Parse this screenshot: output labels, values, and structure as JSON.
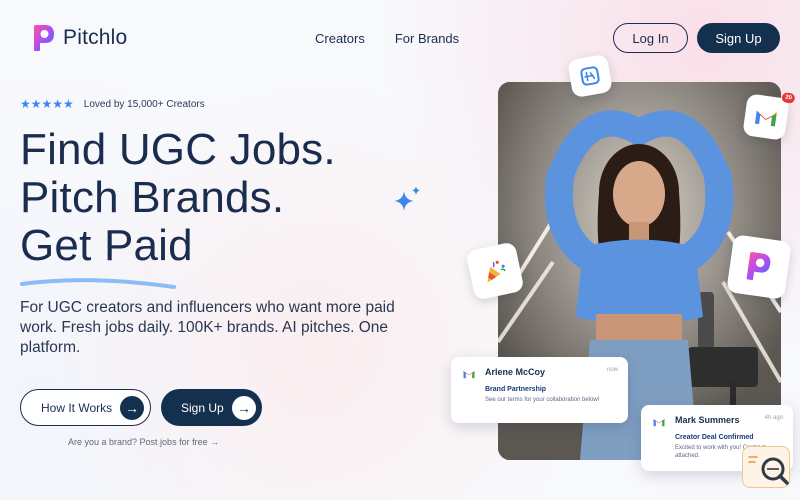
{
  "brand": {
    "name": "Pitchlo"
  },
  "nav": {
    "items": [
      "Creators",
      "For Brands"
    ]
  },
  "auth": {
    "login_label": "Log In",
    "signup_label": "Sign Up"
  },
  "hero": {
    "rating_text": "Loved by 15,000+ Creators",
    "stars": "★★★★★",
    "headline_line1": "Find UGC Jobs.",
    "headline_line2": "Pitch Brands.",
    "headline_line3": "Get Paid",
    "subtitle": "For UGC creators and influencers who want more paid work. Fresh jobs daily. 100K+ brands. AI pitches. One platform.",
    "how_it_works_label": "How It Works",
    "signup_label": "Sign Up",
    "brand_note": "Are you a brand? Post jobs for free →"
  },
  "notifications": [
    {
      "name": "Arlene McCoy",
      "time": "now",
      "subject": "Brand Partnership",
      "body": "See our terms for your collaboration below!"
    },
    {
      "name": "Mark Summers",
      "time": "4h ago",
      "subject": "Creator Deal Confirmed",
      "body": "Excited to work with you! Contract attached."
    }
  ],
  "gmail_badge_count": "20",
  "colors": {
    "navy": "#14304f",
    "star_blue": "#3b86f0",
    "accent_sky": "#8bbcf5"
  }
}
